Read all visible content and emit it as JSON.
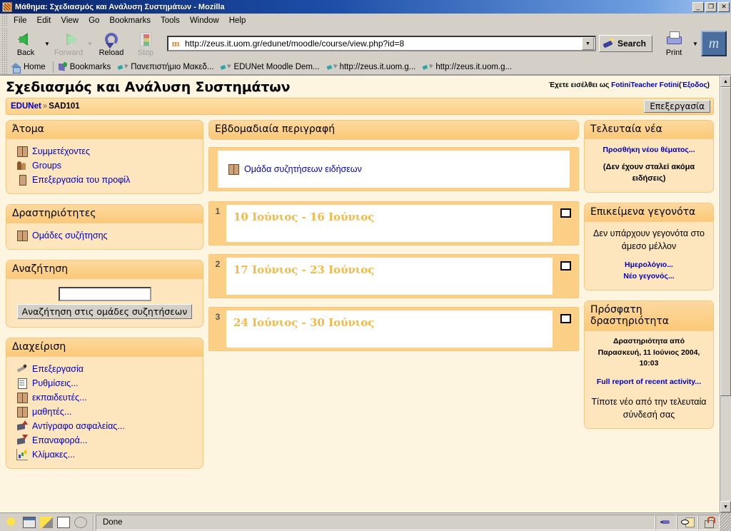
{
  "window": {
    "title": "Μάθημα: Σχεδιασμός και Ανάλυση Συστημάτων - Mozilla",
    "minimize": "_",
    "restore": "❐",
    "close": "✕"
  },
  "menubar": [
    {
      "label": "File"
    },
    {
      "label": "Edit"
    },
    {
      "label": "View"
    },
    {
      "label": "Go"
    },
    {
      "label": "Bookmarks"
    },
    {
      "label": "Tools"
    },
    {
      "label": "Window"
    },
    {
      "label": "Help"
    }
  ],
  "toolbar": {
    "back": "Back",
    "forward": "Forward",
    "reload": "Reload",
    "stop": "Stop",
    "search": "Search",
    "print": "Print",
    "url_value": "http://zeus.it.uom.gr/edunet/moodle/course/view.php?id=8",
    "url_placeholder": "",
    "dropdown_glyph": "▼"
  },
  "bookmarks_bar": [
    {
      "label": "Home",
      "icon": "home-icon"
    },
    {
      "label": "Bookmarks",
      "icon": "bookmarks-folder-icon"
    },
    {
      "label": "Πανεπιστήμιο Μακεδ...",
      "icon": "bookmark-icon"
    },
    {
      "label": "EDUNet Moodle Dem...",
      "icon": "bookmark-icon"
    },
    {
      "label": "http://zeus.it.uom.g...",
      "icon": "bookmark-icon"
    },
    {
      "label": "http://zeus.it.uom.g...",
      "icon": "bookmark-icon"
    }
  ],
  "page": {
    "logged_in_prefix": "Έχετε εισέλθει ως",
    "logged_in_user": "FotiniTeacher Fotini",
    "logout_open": "(",
    "logout": "Έξοδος",
    "logout_close": ")",
    "course_title": "Σχεδιασμός και Ανάλυση Συστημάτων",
    "breadcrumb_root": "EDUNet",
    "breadcrumb_sep": "»",
    "breadcrumb_current": "SAD101",
    "edit_button": "Επεξεργασία"
  },
  "left_blocks": [
    {
      "title": "Άτομα",
      "items": [
        {
          "label": "Συμμετέχοντες",
          "icon": "users-icon"
        },
        {
          "label": "Groups",
          "icon": "group-icon"
        },
        {
          "label": "Επεξεργασία του προφίλ",
          "icon": "user-icon"
        }
      ]
    },
    {
      "title": "Δραστηριότητες",
      "items": [
        {
          "label": "Ομάδες συζήτησης",
          "icon": "users-icon"
        }
      ]
    }
  ],
  "search_block": {
    "title": "Αναζήτηση",
    "input_value": "",
    "input_placeholder": "",
    "button_label": "Αναζήτηση στις ομάδες συζητήσεων"
  },
  "admin_block": {
    "title": "Διαχείριση",
    "items": [
      {
        "label": "Επεξεργασία",
        "icon": "edit-pencil-icon"
      },
      {
        "label": "Ρυθμίσεις...",
        "icon": "settings-doc-icon"
      },
      {
        "label": "εκπαιδευτές...",
        "icon": "users-icon"
      },
      {
        "label": "μαθητές...",
        "icon": "users-icon"
      },
      {
        "label": "Αντίγραφο ασφαλείας...",
        "icon": "backup-box-icon"
      },
      {
        "label": "Επαναφορά...",
        "icon": "restore-box-icon"
      },
      {
        "label": "Κλίμακες...",
        "icon": "scales-chart-icon"
      }
    ]
  },
  "center": {
    "weekly_header": "Εβδομαδιαία περιγραφή",
    "topic0": {
      "link_label": "Ομάδα συζητήσεων ειδήσεων",
      "icon": "forum-icon"
    },
    "weeks": [
      {
        "num": "1",
        "title": "10 Ιούνιος - 16 Ιούνιος",
        "checkbox": "unchecked"
      },
      {
        "num": "2",
        "title": "17 Ιούνιος - 23 Ιούνιος",
        "checkbox": "unchecked"
      },
      {
        "num": "3",
        "title": "24 Ιούνιος - 30 Ιούνιος",
        "checkbox": "unchecked"
      }
    ]
  },
  "right_blocks": {
    "news": {
      "title": "Τελευταία νέα",
      "add_topic_link": "Προσθήκη νέου θέματος...",
      "empty_text": "(Δεν έχουν σταλεί ακόμα ειδήσεις)"
    },
    "events": {
      "title": "Επικείμενα γεγονότα",
      "empty_text": "Δεν υπάρχουν γεγονότα στο άμεσο μέλλον",
      "calendar_link": "Ημερολόγιο...",
      "new_event_link": "Νέο γεγονός..."
    },
    "activity": {
      "title": "Πρόσφατη δραστηριότητα",
      "since_text": "Δραστηριότητα από Παρασκευή, 11 Ιούνιος 2004, 10:03",
      "full_report_link": "Full report of recent activity...",
      "nothing_new": "Τίποτε νέο από την τελευταία σύνδεσή σας"
    }
  },
  "statusbar": {
    "text": "Done",
    "icons": [
      "cookie-icon",
      "popup-icon",
      "composer-icon",
      "addressbook-icon",
      "zoom-icon"
    ],
    "right_icons": [
      "connection-icon",
      "preview-icon",
      "security-lock-icon"
    ]
  },
  "colors": {
    "block_bg": "#fde6bd",
    "block_header": "#fbc978",
    "block_border": "#f3c883",
    "page_bg": "#fdf5e0",
    "week_bg": "#fbcf85",
    "link": "#0000c0",
    "week_title": "#f6b945",
    "titlebar": "#0a246a"
  }
}
